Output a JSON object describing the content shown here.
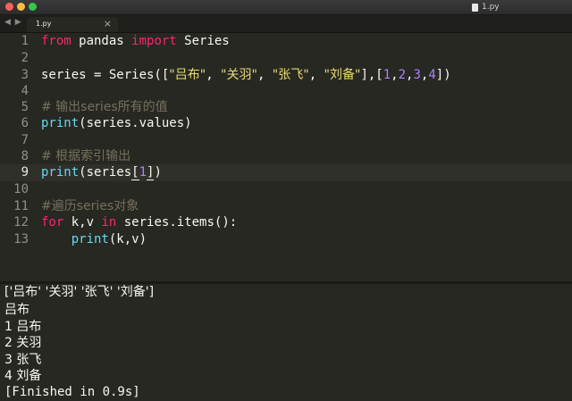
{
  "window": {
    "title": "1.py"
  },
  "tabbar": {
    "nav_arrows": "◀ ▶",
    "tab_label": "1.py",
    "tab_close": "×"
  },
  "editor": {
    "line_numbers": [
      "1",
      "2",
      "3",
      "4",
      "5",
      "6",
      "7",
      "8",
      "9",
      "10",
      "11",
      "12",
      "13"
    ],
    "current_line": "9",
    "lines": [
      {
        "kw1": "from",
        "t1": " pandas ",
        "kw2": "import",
        "t2": " Series"
      },
      {},
      {
        "a": "series = Series([",
        "s1": "\"吕布\"",
        "c1": ", ",
        "s2": "\"关羽\"",
        "c2": ", ",
        "s3": "\"张飞\"",
        "c3": ", ",
        "s4": "\"刘备\"",
        "b": "],[",
        "n1": "1",
        "k1": ",",
        "n2": "2",
        "k2": ",",
        "n3": "3",
        "k3": ",",
        "n4": "4",
        "e": "])"
      },
      {},
      {
        "comment": "# 输出series所有的值"
      },
      {
        "fn": "print",
        "rest": "(series.values)"
      },
      {},
      {
        "comment": "# 根据索引输出"
      },
      {
        "fn": "print",
        "a": "(series",
        "lb": "[",
        "num": "1",
        "rb": "]",
        "e": ")"
      },
      {},
      {
        "comment": "#遍历series对象"
      },
      {
        "kw1": "for",
        "a": " k,v ",
        "kw2": "in",
        "b": " series.items():"
      },
      {
        "indent": "    ",
        "fn": "print",
        "rest": "(k,v)"
      }
    ]
  },
  "output": {
    "lines": [
      "['吕布' '关羽' '张飞' '刘备']",
      "吕布",
      "1 吕布",
      "2 关羽",
      "3 张飞",
      "4 刘备",
      "[Finished in 0.9s]"
    ]
  }
}
